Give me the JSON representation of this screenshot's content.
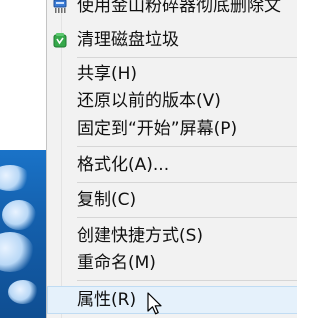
{
  "menu": {
    "items": [
      {
        "label": "使用金山粉碎器彻底删除文",
        "icon": "shredder-icon"
      },
      {
        "label": "清理磁盘垃圾",
        "icon": "recycle-bin-clean-icon"
      },
      {
        "label": "共享(H)"
      },
      {
        "label": "还原以前的版本(V)"
      },
      {
        "label": "固定到“开始”屏幕(P)"
      },
      {
        "label": "格式化(A)..."
      },
      {
        "label": "复制(C)"
      },
      {
        "label": "创建快捷方式(S)"
      },
      {
        "label": "重命名(M)"
      },
      {
        "label": "属性(R)",
        "state": "hovered"
      }
    ]
  },
  "colors": {
    "menu_background": "#f2f2f2",
    "hover_background": "#e5f1fb",
    "hover_border": "#c0dcf3",
    "separator": "#d6d6d6"
  }
}
